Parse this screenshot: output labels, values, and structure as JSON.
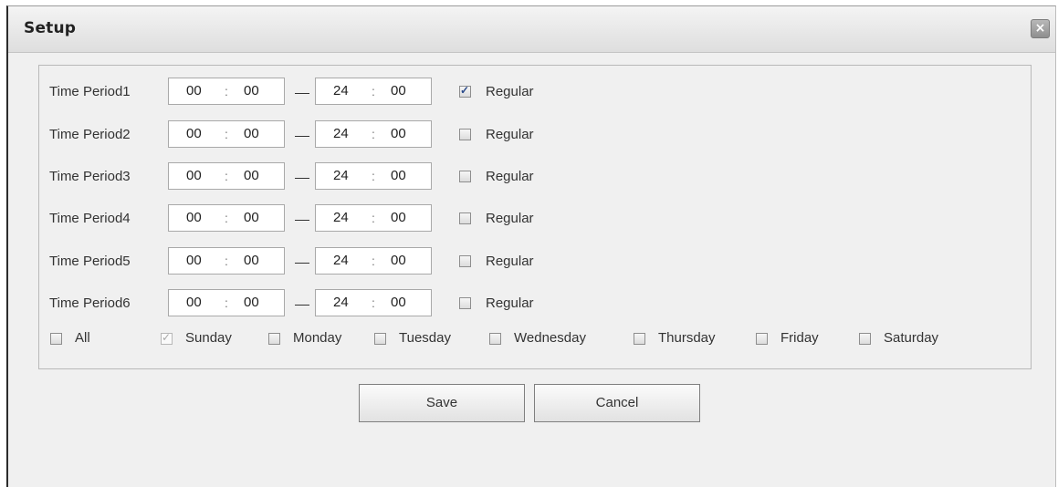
{
  "dialog": {
    "title": "Setup",
    "close_symbol": "×"
  },
  "periods": [
    {
      "label": "Time Period1",
      "start_h": "00",
      "start_m": "00",
      "end_h": "24",
      "end_m": "00",
      "regular_label": "Regular",
      "regular_checked": true
    },
    {
      "label": "Time Period2",
      "start_h": "00",
      "start_m": "00",
      "end_h": "24",
      "end_m": "00",
      "regular_label": "Regular",
      "regular_checked": false
    },
    {
      "label": "Time Period3",
      "start_h": "00",
      "start_m": "00",
      "end_h": "24",
      "end_m": "00",
      "regular_label": "Regular",
      "regular_checked": false
    },
    {
      "label": "Time Period4",
      "start_h": "00",
      "start_m": "00",
      "end_h": "24",
      "end_m": "00",
      "regular_label": "Regular",
      "regular_checked": false
    },
    {
      "label": "Time Period5",
      "start_h": "00",
      "start_m": "00",
      "end_h": "24",
      "end_m": "00",
      "regular_label": "Regular",
      "regular_checked": false
    },
    {
      "label": "Time Period6",
      "start_h": "00",
      "start_m": "00",
      "end_h": "24",
      "end_m": "00",
      "regular_label": "Regular",
      "regular_checked": false
    }
  ],
  "time_separator": ":",
  "days": [
    {
      "label": "All",
      "checked": false,
      "disabled": false
    },
    {
      "label": "Sunday",
      "checked": true,
      "disabled": true
    },
    {
      "label": "Monday",
      "checked": false,
      "disabled": false
    },
    {
      "label": "Tuesday",
      "checked": false,
      "disabled": false
    },
    {
      "label": "Wednesday",
      "checked": false,
      "disabled": false
    },
    {
      "label": "Thursday",
      "checked": false,
      "disabled": false
    },
    {
      "label": "Friday",
      "checked": false,
      "disabled": false
    },
    {
      "label": "Saturday",
      "checked": false,
      "disabled": false
    }
  ],
  "buttons": {
    "save": "Save",
    "cancel": "Cancel"
  }
}
